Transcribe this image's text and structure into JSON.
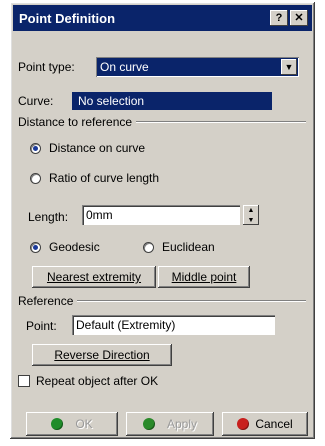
{
  "window": {
    "title": "Point Definition",
    "help_label": "?",
    "close_label": "✕"
  },
  "point_type": {
    "label": "Point type:",
    "value": "On curve"
  },
  "curve": {
    "label": "Curve:",
    "value": "No selection"
  },
  "distance_group": {
    "title": "Distance to reference",
    "option_distance": "Distance on curve",
    "option_ratio": "Ratio of curve length",
    "length_label": "Length:",
    "length_value": "0mm",
    "geodesic_label": "Geodesic",
    "euclidean_label": "Euclidean",
    "nearest_label": "Nearest extremity",
    "middle_label": "Middle point"
  },
  "reference_group": {
    "title": "Reference",
    "point_label": "Point:",
    "point_value": "Default (Extremity)",
    "reverse_label": "Reverse Direction"
  },
  "repeat": {
    "label": "Repeat object after OK"
  },
  "footer": {
    "ok_label": "OK",
    "apply_label": "Apply",
    "cancel_label": "Cancel"
  },
  "colors": {
    "titlebar": "#0a246a",
    "selection": "#0a246a",
    "dialog_bg": "#d4d0c8",
    "ok_dot": "#1f8c2a",
    "apply_dot": "#2a8a2a",
    "cancel_dot": "#c8201e"
  }
}
